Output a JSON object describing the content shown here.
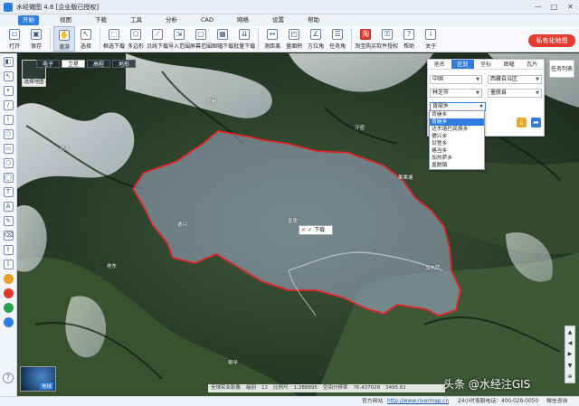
{
  "app": {
    "title": "水经微图 4.8 [企业版已授权]"
  },
  "window_controls": [
    "—",
    "□",
    "✕"
  ],
  "menu": [
    "开始",
    "视图",
    "下载",
    "工具",
    "分析",
    "CAD",
    "网格",
    "设置",
    "帮助"
  ],
  "toolbar": [
    {
      "label": "打开",
      "icon": "folder-open-icon"
    },
    {
      "label": "保存",
      "icon": "save-icon"
    },
    {
      "label": "漫游",
      "icon": "hand-pan-icon",
      "active": true
    },
    {
      "label": "选择",
      "icon": "pointer-icon"
    },
    {
      "label": "框选下载",
      "icon": "box-select-download-icon"
    },
    {
      "label": "多边形",
      "icon": "polygon-icon"
    },
    {
      "label": "沿线下载",
      "icon": "line-download-icon"
    },
    {
      "label": "导入范围",
      "icon": "import-extent-icon"
    },
    {
      "label": "屏幕范围",
      "icon": "screen-extent-icon"
    },
    {
      "label": "图幅下载",
      "icon": "sheet-download-icon"
    },
    {
      "label": "批量下载",
      "icon": "batch-download-icon"
    },
    {
      "label": "测距离",
      "icon": "measure-distance-icon"
    },
    {
      "label": "量面积",
      "icon": "measure-area-icon"
    },
    {
      "label": "方位角",
      "icon": "azimuth-icon"
    },
    {
      "label": "任务角",
      "icon": "task-icon"
    },
    {
      "label": "淘宝购买",
      "icon": "taobao-icon",
      "red": true
    },
    {
      "label": "软件授权",
      "icon": "license-icon"
    },
    {
      "label": "帮助",
      "icon": "help-icon"
    },
    {
      "label": "关于",
      "icon": "about-icon"
    }
  ],
  "private_button": "私有化地图",
  "map_types": [
    "电子",
    "卫星",
    "高程",
    "地形"
  ],
  "map_thumb_caption": "选择地图",
  "region_panel": {
    "tabs": [
      "地名",
      "区划",
      "坐标",
      "图幅",
      "瓦片"
    ],
    "active_tab": "区划",
    "country": "中国",
    "province": "西藏自治区",
    "city": "林芝市",
    "county": "墨脱县",
    "town": "背崩乡"
  },
  "town_options": [
    "背崩乡",
    "背崩乡",
    "达木珞巴民族乡",
    "德兴乡",
    "甘登乡",
    "格当乡",
    "加热萨乡",
    "墨脱镇"
  ],
  "town_selected_index": 1,
  "task_list": "任务列表",
  "download_popup": {
    "label": "下载"
  },
  "map_labels": [
    "背崩",
    "汗密",
    "果果塘",
    "德兴",
    "墨脱",
    "达木",
    "帮辛",
    "公墨",
    "加热萨",
    "地东"
  ],
  "globe_caption": "地球",
  "right_nav": [
    "▲",
    "◀",
    "▶",
    "▼",
    "⊕"
  ],
  "map_status": {
    "layer": "全球实业影像",
    "level_label": "级别",
    "level": "12",
    "scale_label": "比例尺",
    "scale": "1:288895",
    "resolution_label": "空间分辨率",
    "resolution": "76.437028",
    "coords": "3495.81"
  },
  "statusbar": {
    "site_label": "官方网站",
    "site_url": "http://www.rivermap.cn",
    "hotline": "24小时客服电话：400-028-0050",
    "wechat": "微信咨询"
  },
  "watermark": "头条 @水经注GIS",
  "colors": {
    "accent": "#2f7de1",
    "boundary": "#e0262a",
    "brand_red": "#e43b2d"
  }
}
